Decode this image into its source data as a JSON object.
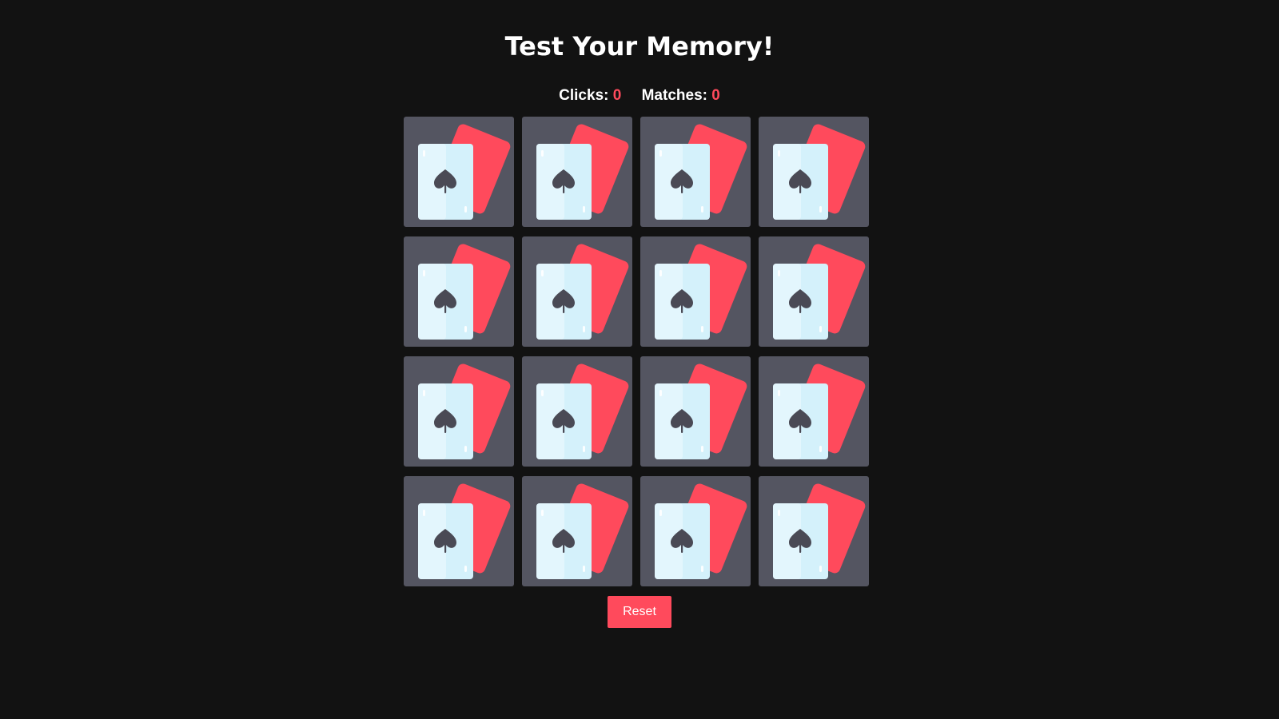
{
  "game": {
    "title": "Test Your Memory!",
    "clicks_label": "Clicks:",
    "clicks_value": "0",
    "matches_label": "Matches:",
    "matches_value": "0",
    "reset_label": "Reset",
    "rows": 4,
    "cols": 4,
    "card_back_icon": "playing-cards-icon",
    "colors": {
      "background": "#121212",
      "tile": "#545561",
      "accent": "#ff4a5c",
      "card_face": "#d4f1fb",
      "spade": "#4a4a55"
    }
  }
}
